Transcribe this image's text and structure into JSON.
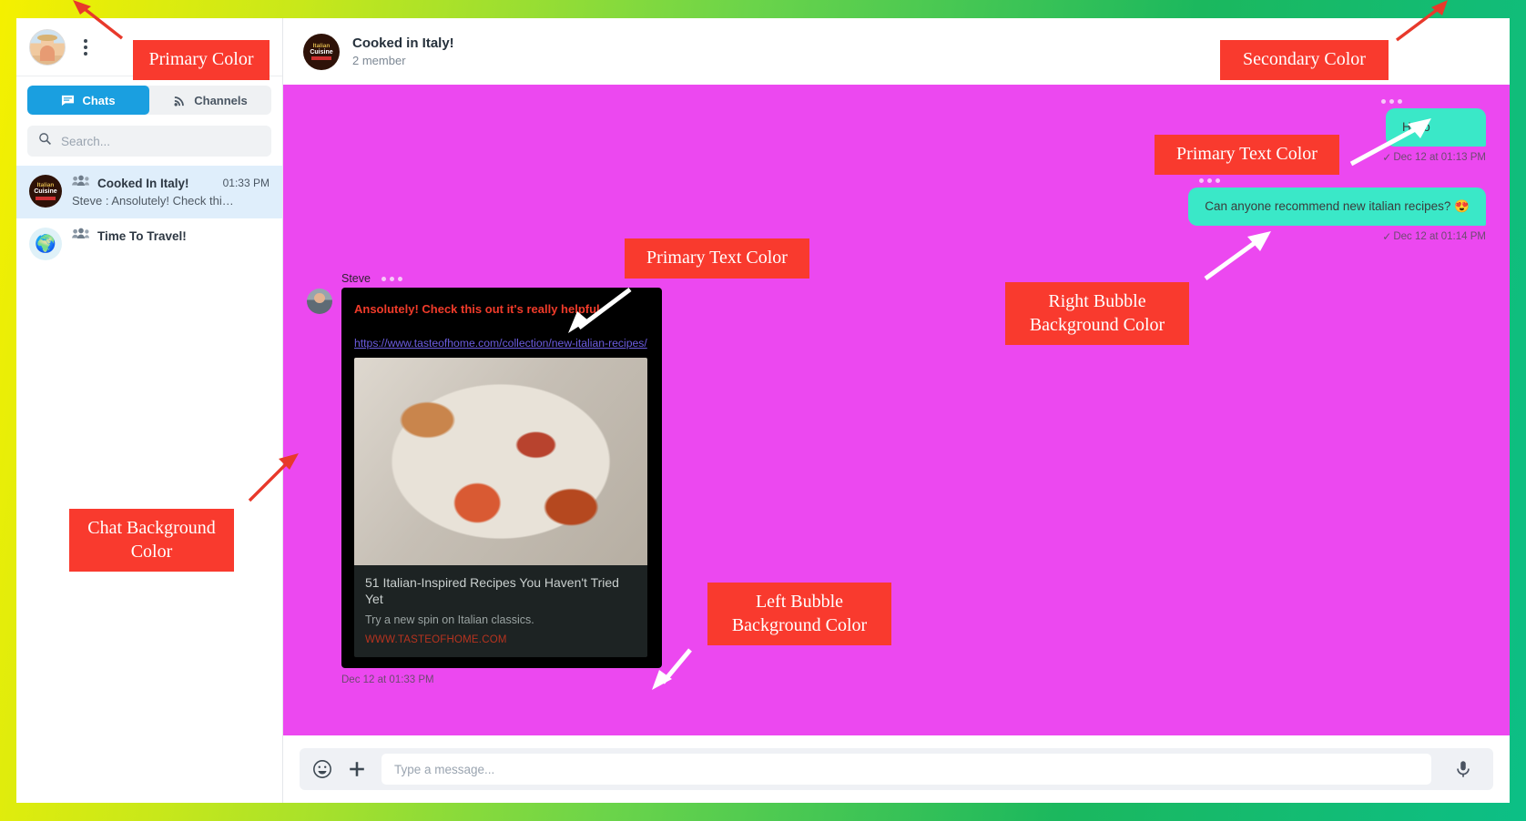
{
  "sidebar": {
    "user_avatar": "user-avatar",
    "menu_icon": "kebab-menu-icon",
    "tabs": [
      {
        "label": "Chats",
        "icon": "chat-bubble-icon",
        "active": true
      },
      {
        "label": "Channels",
        "icon": "rss-broadcast-icon",
        "active": false
      }
    ],
    "search": {
      "placeholder": "Search...",
      "value": "",
      "icon": "search-icon"
    },
    "chats": [
      {
        "avatar": "italian-cuisine-logo",
        "title": "Cooked In Italy!",
        "time": "01:33 PM",
        "snippet": "Steve : Ansolutely! Check thi…",
        "group_icon": "group-people-icon",
        "selected": true
      },
      {
        "avatar": "time-to-travel-globe",
        "title": "Time To Travel!",
        "time": "",
        "snippet": "",
        "group_icon": "group-people-icon",
        "selected": false
      }
    ]
  },
  "conversation": {
    "avatar": "italian-cuisine-logo",
    "title": "Cooked in Italy!",
    "members": "2 member",
    "messages": [
      {
        "side": "right",
        "text": "Hello",
        "timestamp": "Dec 12 at 01:13 PM",
        "read_tick": "✓",
        "typing_indicator": true
      },
      {
        "side": "right",
        "text": "Can anyone recommend new italian recipes? 😍",
        "timestamp": "Dec 12 at 01:14 PM",
        "read_tick": "✓",
        "typing_indicator": true
      },
      {
        "side": "left",
        "sender": "Steve",
        "text": "Ansolutely! Check this out it's really helpful",
        "link": "https://www.tasteofhome.com/collection/new-italian-recipes/",
        "preview": {
          "title": "51 Italian-Inspired Recipes You Haven't Tried Yet",
          "description": "Try a new spin on Italian classics.",
          "source": "WWW.TASTEOFHOME.COM",
          "image": "bruschetta-photo"
        },
        "timestamp": "Dec 12 at 01:33 PM",
        "typing_indicator": true
      }
    ]
  },
  "composer": {
    "emoji_icon": "emoji-smiley-icon",
    "attach_icon": "plus-attach-icon",
    "mic_icon": "microphone-icon",
    "placeholder": "Type a message...",
    "value": ""
  },
  "annotations": [
    {
      "id": "primary-color",
      "text": "Primary Color"
    },
    {
      "id": "secondary-color",
      "text": "Secondary Color"
    },
    {
      "id": "primary-text-color-right",
      "text": "Primary Text Color"
    },
    {
      "id": "primary-text-color-left",
      "text": "Primary Text Color"
    },
    {
      "id": "right-bubble-bg",
      "text": "Right Bubble\nBackground Color"
    },
    {
      "id": "left-bubble-bg",
      "text": "Left Bubble\nBackground Color"
    },
    {
      "id": "chat-background",
      "text": "Chat Background\nColor"
    }
  ],
  "colors": {
    "primary": "#ffffff",
    "secondary": "#ffffff",
    "chat_background": "#ec48f0",
    "right_bubble": "#3ae8c8",
    "left_bubble": "#000000",
    "primary_text": "#3b3b3b",
    "accent_blue": "#1a9fe0",
    "annotation_red": "#f93a2e",
    "page_border_gradient": "yellow-to-green"
  }
}
